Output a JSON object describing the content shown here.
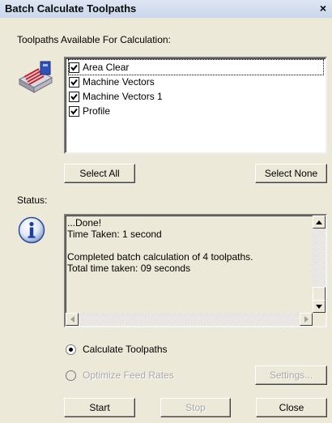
{
  "window": {
    "title": "Batch Calculate Toolpaths",
    "close_label": "×"
  },
  "toolpaths": {
    "heading": "Toolpaths Available For Calculation:",
    "items": [
      {
        "label": "Area Clear",
        "checked": true
      },
      {
        "label": "Machine Vectors",
        "checked": true
      },
      {
        "label": "Machine Vectors 1",
        "checked": true
      },
      {
        "label": "Profile",
        "checked": true
      }
    ]
  },
  "buttons": {
    "select_all": "Select All",
    "select_none": "Select None",
    "settings": "Settings...",
    "start": "Start",
    "stop": "Stop",
    "close": "Close"
  },
  "status": {
    "heading": "Status:",
    "lines": [
      "...Done!",
      "Time Taken: 1 second",
      "",
      "Completed batch calculation of 4 toolpaths.",
      "Total time taken: 09 seconds"
    ]
  },
  "options": {
    "calculate": {
      "label": "Calculate Toolpaths",
      "selected": true
    },
    "optimize": {
      "label": "Optimize Feed Rates",
      "selected": false,
      "enabled": false
    }
  }
}
